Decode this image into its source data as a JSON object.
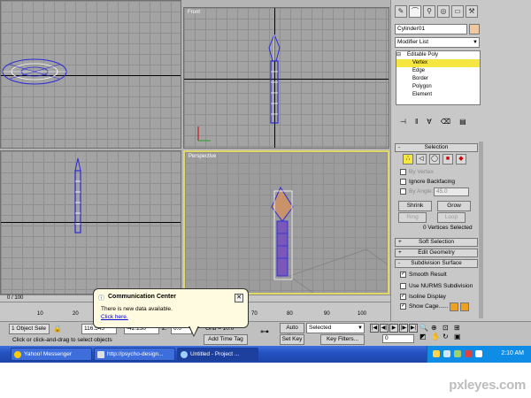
{
  "viewports": {
    "front_label": "Front",
    "perspective_label": "Perspective"
  },
  "panel": {
    "object_name": "Cylinder01",
    "object_color": "#f0c8a0",
    "modifier_list": "Modifier List",
    "stack": [
      {
        "label": "Editable Poly",
        "prefix": "⊟"
      },
      {
        "label": "Vertex"
      },
      {
        "label": "Edge"
      },
      {
        "label": "Border"
      },
      {
        "label": "Polygon"
      },
      {
        "label": "Element"
      }
    ],
    "selection": {
      "title": "Selection",
      "by_vertex": "By Vertex",
      "ignore_backfacing": "Ignore Backfacing",
      "by_angle": "By Angle:",
      "angle_value": "45.0",
      "shrink": "Shrink",
      "grow": "Grow",
      "ring": "Ring",
      "loop": "Loop",
      "status": "0 Vertices Selected"
    },
    "rollouts": {
      "soft_selection": "Soft Selection",
      "edit_geometry": "Edit Geometry",
      "subdivision_surface": "Subdivision Surface"
    },
    "subdivision": {
      "smooth_result": "Smooth Result",
      "use_nurms": "Use NURMS Subdivision",
      "isoline": "Isoline Display",
      "show_cage": "Show Cage......"
    }
  },
  "timeline": {
    "frame": "0 / 100",
    "ticks": [
      "10",
      "20",
      "70",
      "80",
      "90",
      "100"
    ]
  },
  "status": {
    "object_selected": "1 Object Sele",
    "x_value": "116.545",
    "y_value": "-42.230",
    "z_label": "Z:",
    "z_value": "0.0",
    "grid": "Grid = 10.0",
    "add_time_tag": "Add Time Tag",
    "prompt": "Click or click-and-drag to select objects",
    "auto_key": "Auto Key",
    "set_key": "Set Key",
    "key_mode": "Selected",
    "key_filters": "Key Filters...",
    "frame_value": "0"
  },
  "comm_center": {
    "title": "Communication Center",
    "body": "There is new data available.",
    "link": "Click here."
  },
  "taskbar": {
    "items": [
      "Yahoo! Messenger",
      "http://psycho-design...",
      "Untitled   - Project ..."
    ],
    "clock": "2:10 AM"
  },
  "watermark": "pxleyes.com"
}
